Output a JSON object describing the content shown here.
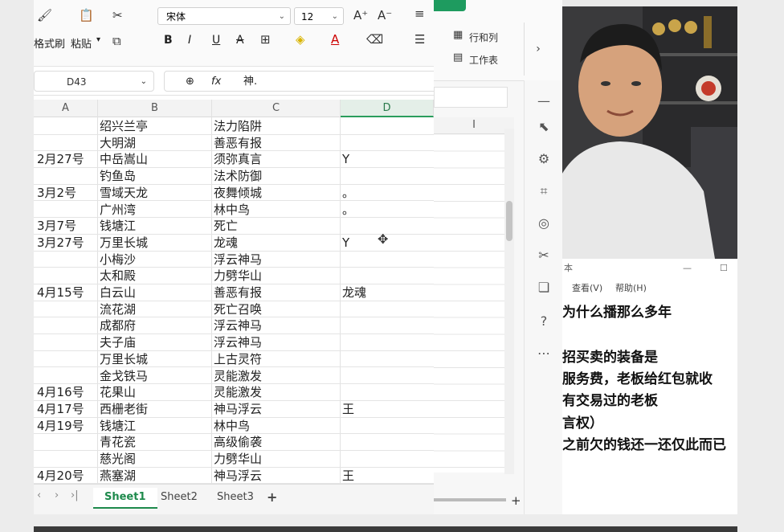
{
  "ribbon": {
    "format_painter": "格式刷",
    "paste": "粘贴",
    "font_name": "宋体",
    "font_size": "12",
    "bold": "B",
    "italic": "I",
    "underline": "U",
    "strike": "A",
    "font_color": "A",
    "rows_cols": "行和列",
    "worksheet": "工作表"
  },
  "formula_bar": {
    "cell_ref": "D43",
    "fx": "fx",
    "content": "神."
  },
  "columns": [
    "A",
    "B",
    "C",
    "D"
  ],
  "rows": [
    [
      "",
      "绍兴兰亭",
      "法力陷阱",
      ""
    ],
    [
      "",
      "大明湖",
      "善恶有报",
      ""
    ],
    [
      "2月27号",
      "中岳嵩山",
      "须弥真言",
      "Y"
    ],
    [
      "",
      "钓鱼岛",
      "法术防御",
      ""
    ],
    [
      "3月2号",
      "雪域天龙",
      "夜舞倾城",
      "。"
    ],
    [
      "",
      "广州湾",
      "林中鸟",
      "。"
    ],
    [
      "3月7号",
      "钱塘江",
      "死亡",
      ""
    ],
    [
      "3月27号",
      "万里长城",
      "龙魂",
      "Y"
    ],
    [
      "",
      "小梅沙",
      "浮云神马",
      ""
    ],
    [
      "",
      "太和殿",
      "力劈华山",
      ""
    ],
    [
      "4月15号",
      "白云山",
      "善恶有报",
      "龙魂"
    ],
    [
      "",
      "流花湖",
      "死亡召唤",
      ""
    ],
    [
      "",
      "成都府",
      "浮云神马",
      ""
    ],
    [
      "",
      "夫子庙",
      "浮云神马",
      ""
    ],
    [
      "",
      "万里长城",
      "上古灵符",
      ""
    ],
    [
      "",
      "金戈铁马",
      "灵能激发",
      ""
    ],
    [
      "4月16号",
      "花果山",
      "灵能激发",
      ""
    ],
    [
      "4月17号",
      "西栅老街",
      "神马浮云",
      "王"
    ],
    [
      "4月19号",
      "钱塘江",
      "林中鸟",
      ""
    ],
    [
      "",
      "青花瓷",
      "高级偷袭",
      ""
    ],
    [
      "",
      "慈光阁",
      "力劈华山",
      ""
    ],
    [
      "4月20号",
      "燕塞湖",
      "神马浮云",
      "王"
    ]
  ],
  "sheets": [
    "Sheet1",
    "Sheet2",
    "Sheet3"
  ],
  "add_sheet": "+",
  "mid_column": "I",
  "notepad": {
    "title": "本",
    "menu": [
      "查看(V)",
      "帮助(H)"
    ],
    "lines": [
      "为什么播那么多年",
      "",
      "招买卖的装备是",
      "服务费，老板给红包就收",
      "有交易过的老板",
      "言权）",
      "之前欠的钱还一还仅此而已"
    ]
  }
}
